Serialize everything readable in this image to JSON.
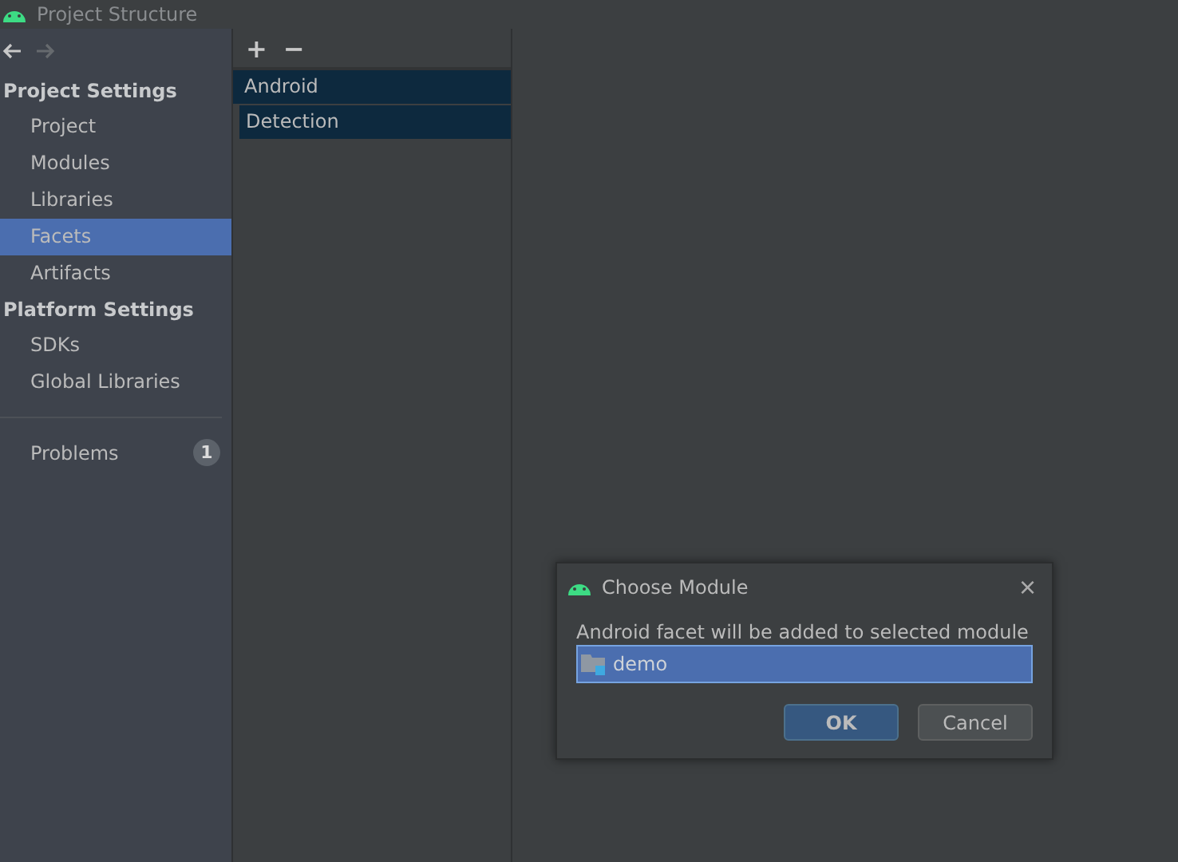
{
  "window": {
    "title": "Project Structure"
  },
  "sidebar": {
    "sections": [
      {
        "title": "Project Settings",
        "items": [
          {
            "label": "Project",
            "selected": false
          },
          {
            "label": "Modules",
            "selected": false
          },
          {
            "label": "Libraries",
            "selected": false
          },
          {
            "label": "Facets",
            "selected": true
          },
          {
            "label": "Artifacts",
            "selected": false
          }
        ]
      },
      {
        "title": "Platform Settings",
        "items": [
          {
            "label": "SDKs",
            "selected": false
          },
          {
            "label": "Global Libraries",
            "selected": false
          }
        ]
      }
    ],
    "problems": {
      "label": "Problems",
      "count": "1"
    }
  },
  "toolbar": {
    "add": "+",
    "remove": "−"
  },
  "facets": [
    {
      "label": "Android",
      "selected": true
    },
    {
      "label": "Detection",
      "selected": true
    }
  ],
  "dialog": {
    "title": "Choose Module",
    "close": "×",
    "message": "Android facet will be added to selected module",
    "modules": [
      {
        "label": "demo",
        "selected": true
      }
    ],
    "buttons": [
      {
        "label": "OK",
        "kind": "primary"
      },
      {
        "label": "Cancel",
        "kind": "secondary"
      }
    ]
  }
}
